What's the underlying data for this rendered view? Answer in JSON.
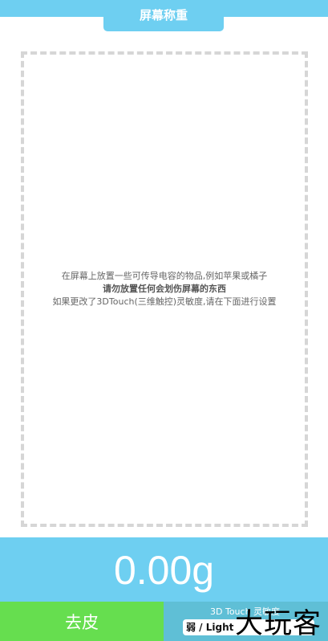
{
  "header": {
    "title": "屏幕称重"
  },
  "instructions": {
    "line1": "在屏幕上放置一些可传导电容的物品,例如苹果或橘子",
    "line2": "请勿放置任何会划伤屏幕的东西",
    "line3": "如果更改了3DTouch(三维触控)灵敏度,请在下面进行设置"
  },
  "display": {
    "weight": "0.00g"
  },
  "controls": {
    "tare_label": "去皮",
    "sensitivity_label": "3D Touch 灵敏度",
    "sensitivity_value": "弱 / Light"
  },
  "watermark": {
    "text": "大玩客"
  },
  "colors": {
    "primary": "#6ecff1",
    "tare": "#66de4f",
    "panel": "#5fbfd6"
  }
}
